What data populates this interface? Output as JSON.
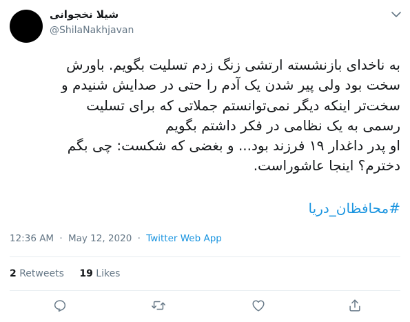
{
  "author": {
    "name": "شیلا نخجوانی",
    "handle": "@ShilaNakhjavan"
  },
  "tweet": {
    "text_lines": [
      "به ناخدای بازنشسته ارتشی زنگ زدم تسلیت بگویم. باورش",
      "سخت بود ولی پیر شدن یک آدم را حتی در صدایش شنیدم و",
      "سخت‌تر اینکه دیگر نمی‌توانستم جملاتی که برای تسلیت",
      "رسمی به یک نظامی در فکر داشتم بگویم",
      "او پدر داغدار ۱۹ فرزند بود... و بغضی که شکست: چی بگم",
      "دخترم؟ اینجا عاشوراست."
    ],
    "hashtag": "#محافظان_دریا"
  },
  "meta": {
    "time": "12:36 AM",
    "separator": "·",
    "date": "May 12, 2020",
    "source": "Twitter Web App"
  },
  "stats": {
    "retweets_count": "2",
    "retweets_label": "Retweets",
    "likes_count": "19",
    "likes_label": "Likes"
  },
  "colors": {
    "accent": "#1b95e0",
    "muted": "#657786",
    "divider": "#e6ecf0",
    "text": "#14171a"
  },
  "icons": [
    "caret-down-icon",
    "reply-icon",
    "retweet-icon",
    "like-icon",
    "share-icon"
  ]
}
